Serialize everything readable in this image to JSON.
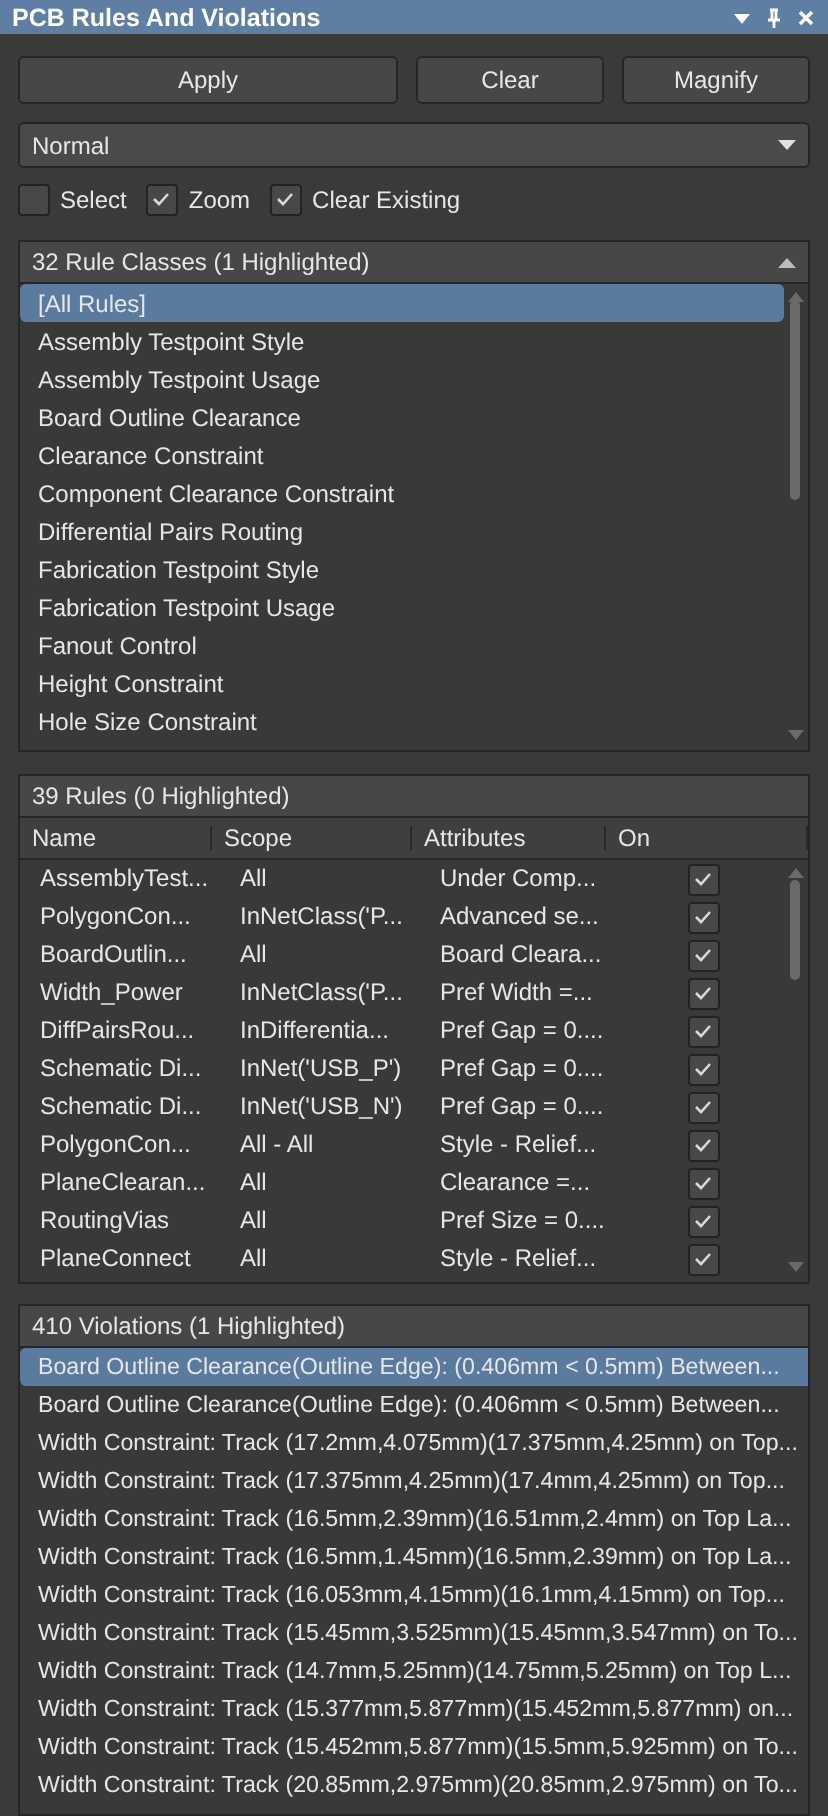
{
  "window": {
    "title": "PCB Rules And Violations"
  },
  "buttons": [
    "Apply",
    "Clear",
    "Magnify"
  ],
  "mode_dropdown": {
    "value": "Normal"
  },
  "options": [
    {
      "label": "Select",
      "checked": false
    },
    {
      "label": "Zoom",
      "checked": true
    },
    {
      "label": "Clear Existing",
      "checked": true
    }
  ],
  "rule_classes": {
    "header": "32 Rule Classes (1 Highlighted)",
    "items": [
      {
        "label": "[All Rules]",
        "selected": true
      },
      {
        "label": "Assembly Testpoint Style",
        "selected": false
      },
      {
        "label": "Assembly Testpoint Usage",
        "selected": false
      },
      {
        "label": "Board Outline Clearance",
        "selected": false
      },
      {
        "label": "Clearance Constraint",
        "selected": false
      },
      {
        "label": "Component Clearance Constraint",
        "selected": false
      },
      {
        "label": "Differential Pairs Routing",
        "selected": false
      },
      {
        "label": "Fabrication Testpoint Style",
        "selected": false
      },
      {
        "label": "Fabrication Testpoint Usage",
        "selected": false
      },
      {
        "label": "Fanout Control",
        "selected": false
      },
      {
        "label": "Height Constraint",
        "selected": false
      },
      {
        "label": "Hole Size Constraint",
        "selected": false
      }
    ]
  },
  "rules": {
    "header": "39 Rules (0 Highlighted)",
    "columns": [
      "Name",
      "Scope",
      "Attributes",
      "On"
    ],
    "rows": [
      {
        "name": "AssemblyTest...",
        "scope": "All",
        "attributes": "Under Comp...",
        "on": true
      },
      {
        "name": "PolygonCon...",
        "scope": "InNetClass('P...",
        "attributes": "Advanced se...",
        "on": true
      },
      {
        "name": "BoardOutlin...",
        "scope": "All",
        "attributes": "Board Cleara...",
        "on": true
      },
      {
        "name": "Width_Power",
        "scope": "InNetClass('P...",
        "attributes": "Pref Width =...",
        "on": true
      },
      {
        "name": "DiffPairsRou...",
        "scope": "InDifferentia...",
        "attributes": "Pref Gap = 0....",
        "on": true
      },
      {
        "name": "Schematic Di...",
        "scope": "InNet('USB_P')",
        "attributes": "Pref Gap = 0....",
        "on": true
      },
      {
        "name": "Schematic Di...",
        "scope": "InNet('USB_N')",
        "attributes": "Pref Gap = 0....",
        "on": true
      },
      {
        "name": "PolygonCon...",
        "scope": "All - All",
        "attributes": "Style - Relief...",
        "on": true
      },
      {
        "name": "PlaneClearan...",
        "scope": "All",
        "attributes": "Clearance =...",
        "on": true
      },
      {
        "name": "RoutingVias",
        "scope": "All",
        "attributes": "Pref Size = 0....",
        "on": true
      },
      {
        "name": "PlaneConnect",
        "scope": "All",
        "attributes": "Style - Relief...",
        "on": true
      }
    ]
  },
  "violations": {
    "header": "410 Violations (1 Highlighted)",
    "items": [
      {
        "label": "Board Outline Clearance(Outline Edge): (0.406mm < 0.5mm) Between...",
        "selected": true
      },
      {
        "label": "Board Outline Clearance(Outline Edge): (0.406mm < 0.5mm) Between...",
        "selected": false
      },
      {
        "label": "Width Constraint: Track (17.2mm,4.075mm)(17.375mm,4.25mm) on Top...",
        "selected": false
      },
      {
        "label": "Width Constraint: Track (17.375mm,4.25mm)(17.4mm,4.25mm) on Top...",
        "selected": false
      },
      {
        "label": "Width Constraint: Track (16.5mm,2.39mm)(16.51mm,2.4mm) on Top La...",
        "selected": false
      },
      {
        "label": "Width Constraint: Track (16.5mm,1.45mm)(16.5mm,2.39mm) on Top La...",
        "selected": false
      },
      {
        "label": "Width Constraint: Track (16.053mm,4.15mm)(16.1mm,4.15mm) on Top...",
        "selected": false
      },
      {
        "label": "Width Constraint: Track (15.45mm,3.525mm)(15.45mm,3.547mm) on To...",
        "selected": false
      },
      {
        "label": "Width Constraint: Track (14.7mm,5.25mm)(14.75mm,5.25mm) on Top L...",
        "selected": false
      },
      {
        "label": "Width Constraint: Track (15.377mm,5.877mm)(15.452mm,5.877mm) on...",
        "selected": false
      },
      {
        "label": "Width Constraint: Track (15.452mm,5.877mm)(15.5mm,5.925mm) on To...",
        "selected": false
      },
      {
        "label": "Width Constraint: Track (20.85mm,2.975mm)(20.85mm,2.975mm) on To...",
        "selected": false
      }
    ]
  }
}
